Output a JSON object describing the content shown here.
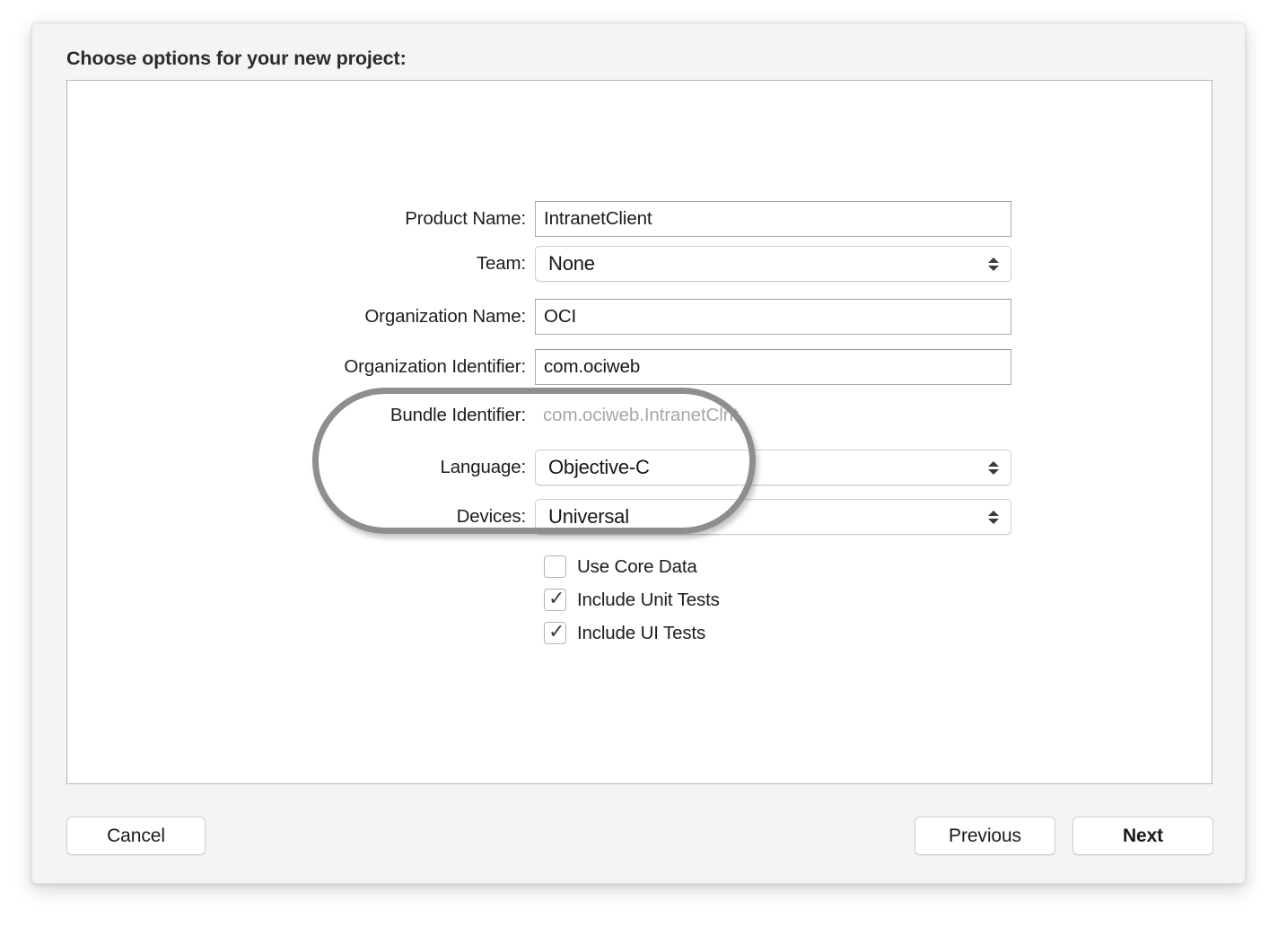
{
  "dialog": {
    "title": "Choose options for your new project:",
    "fields": [
      {
        "label": "Product Name:",
        "value": "IntranetClient",
        "kind": "text"
      },
      {
        "label": "Team:",
        "value": "None",
        "kind": "popup"
      },
      {
        "label": "Organization Name:",
        "value": "OCI",
        "kind": "text"
      },
      {
        "label": "Organization Identifier:",
        "value": "com.ociweb",
        "kind": "text"
      },
      {
        "label": "Bundle Identifier:",
        "value": "com.ociweb.IntranetClnt",
        "kind": "static"
      },
      {
        "label": "Language:",
        "value": "Objective-C",
        "kind": "popup"
      },
      {
        "label": "Devices:",
        "value": "Universal",
        "kind": "popup"
      }
    ],
    "checkboxes": [
      {
        "label": "Use Core Data",
        "checked": false,
        "tick": ""
      },
      {
        "label": "Include Unit Tests",
        "checked": true,
        "tick": "✓"
      },
      {
        "label": "Include UI Tests",
        "checked": true,
        "tick": "✓"
      }
    ],
    "buttons": {
      "cancel": "Cancel",
      "previous": "Previous",
      "next": "Next"
    }
  },
  "annotation": {
    "shape": "rounded-oval-highlight",
    "color": "#8e8e8e",
    "covers": [
      "Bundle Identifier:",
      "Language:"
    ]
  },
  "colors": {
    "dialog_background": "#f4f4f4",
    "content_background": "#ffffff",
    "text": "#1d1d1d",
    "disabled_text": "#a7a7a7",
    "field_border": "#a9a9a9",
    "popup_border": "#cfcfcf",
    "annotation": "#8e8e8e"
  }
}
